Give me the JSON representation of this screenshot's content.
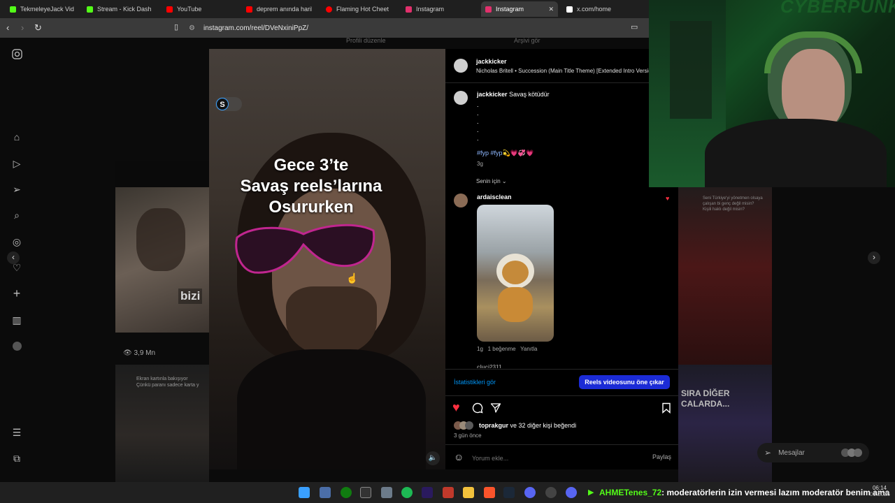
{
  "browser": {
    "tabs": [
      {
        "label": "TekmeleyeJack Videos",
        "color": "#53fc18"
      },
      {
        "label": "Stream - Kick Dash",
        "color": "#53fc18"
      },
      {
        "label": "YouTube",
        "color": "#ff0000"
      },
      {
        "label": "deprem anında harika",
        "color": "#ff0000"
      },
      {
        "label": "Flaming Hot Cheet",
        "color": "#ff0000"
      },
      {
        "label": "Instagram",
        "color": "#e1306c"
      },
      {
        "label": "Instagram",
        "color": "#e1306c"
      },
      {
        "label": "x.com/home",
        "color": "#ffffff"
      }
    ],
    "url": "instagram.com/reel/DVeNxiniPpZ/"
  },
  "profile_bar": {
    "edit": "Profili düzenle",
    "archive": "Arşivi gör"
  },
  "grid": {
    "views": "3,9 Mn",
    "tile_bizi": "bizi",
    "tile_caption": "Ekran kartınla bakışıyor\nÇünkü paranı sadece karta y",
    "tile_sira": "SIRA DİĞER\nCALARDA...",
    "tile_question": "Seni Türkiye'yi yönetmen olsaya\nçalışan bi genç değil misin?\nKişili haklı değil misin?"
  },
  "reel": {
    "badge": "S",
    "overlay_text_1": "Gece 3’te",
    "overlay_text_2": "Savaş reels’larına",
    "overlay_text_3": "Osururken"
  },
  "panel": {
    "author": "jackkicker",
    "audio": "Nicholas Britell • Succession (Main Title Theme) [Extended Intro Version]",
    "caption_user": "jackkicker",
    "caption_text": "Savaş kötüdür",
    "dots": [
      ".",
      ".",
      ".",
      ".",
      "."
    ],
    "hashtags": "#fyp #fyp💫💗💞💗",
    "caption_time": "3g",
    "sort": "Senin için",
    "comment": {
      "user": "ardaisclean",
      "time": "1g",
      "likes": "1 beğenme",
      "reply": "Yanıtla"
    },
    "next_comment_user": "cluci2311",
    "insights": "İstatistikleri gör",
    "boost": "Reels videosunu öne çıkar",
    "liked_by_user": "toprakgur",
    "liked_by_others": "ve 32 diğer kişi beğendi",
    "posted": "3 gün önce",
    "comment_placeholder": "Yorum ekle...",
    "share": "Paylaş"
  },
  "messages": "Mesajlar",
  "taskbar": {
    "chat_user": "AHMETenes_72",
    "chat_text": ": moderatörlerin izin vermesi lazım moderatör benim ama",
    "time": "06:14",
    "date": "03.2026"
  },
  "cam": {
    "logo": "CYBERPUNK"
  },
  "colors": {
    "accent": "#0095f6",
    "boost": "#1b2bd6",
    "like": "#ff3040"
  }
}
